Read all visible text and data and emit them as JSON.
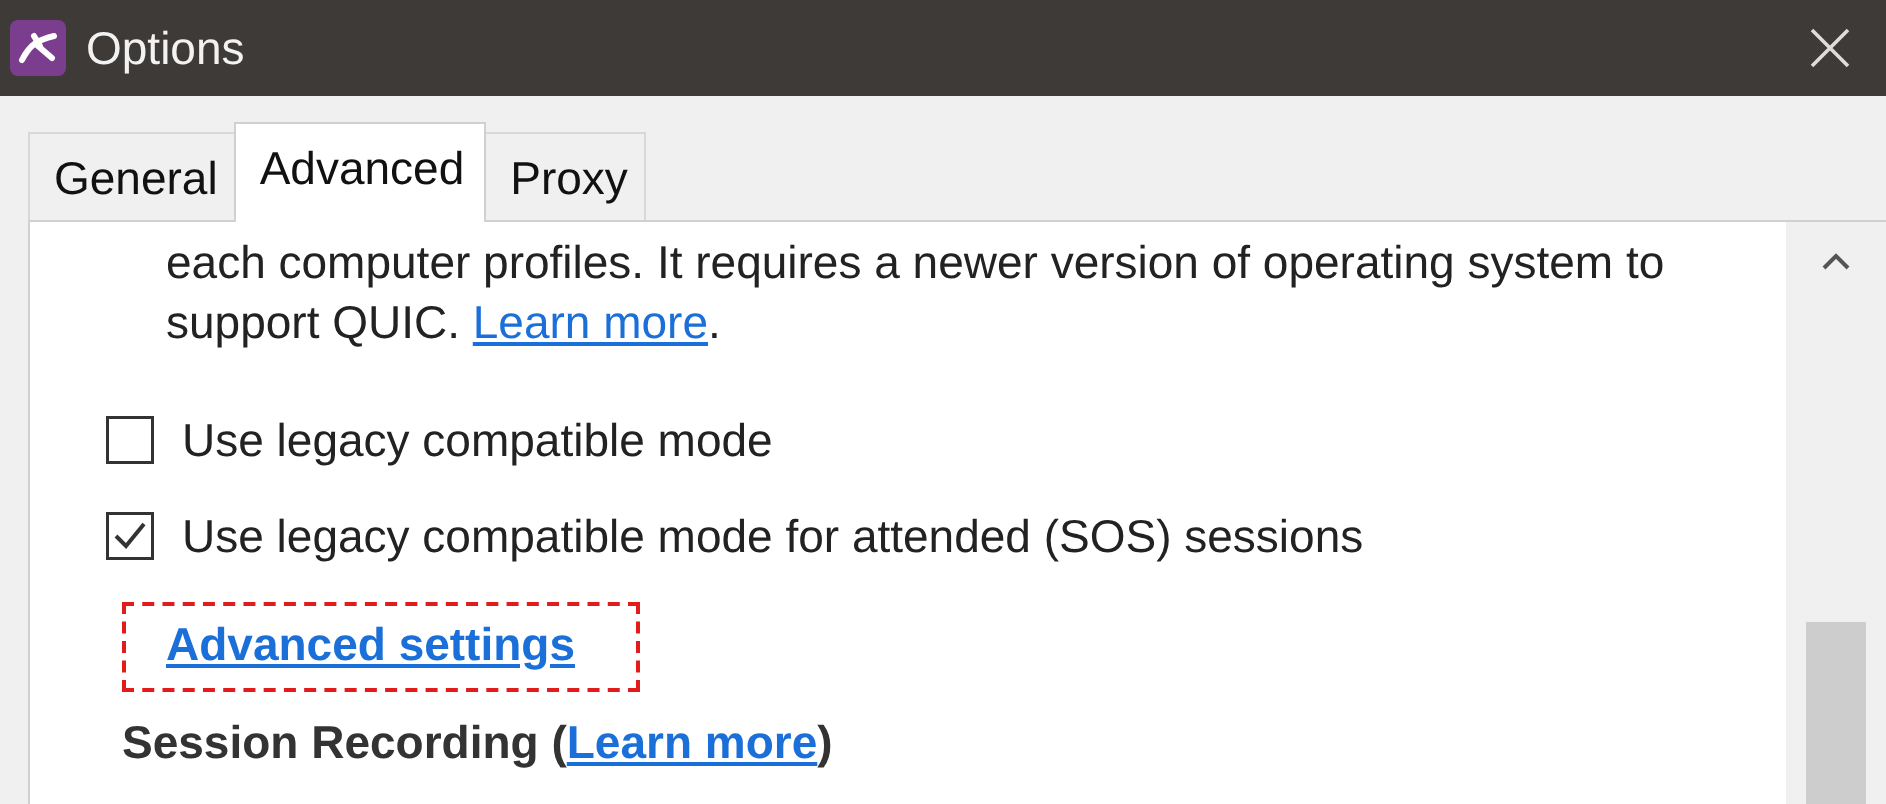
{
  "window": {
    "title": "Options"
  },
  "tabs": [
    {
      "label": "General",
      "selected": false
    },
    {
      "label": "Advanced",
      "selected": true
    },
    {
      "label": "Proxy",
      "selected": false
    }
  ],
  "paragraph": {
    "text": "each computer profiles. It requires a newer version of operating system to support QUIC.",
    "link": "Learn more",
    "end": "."
  },
  "options": [
    {
      "label": "Use legacy compatible mode",
      "checked": false
    },
    {
      "label": "Use legacy compatible mode for attended (SOS) sessions",
      "checked": true
    }
  ],
  "advanced_link": {
    "label": "Advanced settings",
    "highlighted": true
  },
  "section": {
    "title": "Session Recording",
    "open": "(",
    "link": "Learn more",
    "close": ")"
  }
}
